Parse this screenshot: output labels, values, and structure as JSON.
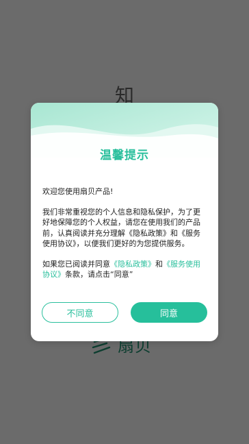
{
  "background": {
    "top_char": "知",
    "logo_text": "扇贝",
    "logo_icon": "shanbay-logo-icon"
  },
  "dialog": {
    "title": "温馨提示",
    "welcome": "欢迎您使用扇贝产品!",
    "body": "我们非常重视您的个人信息和隐私保护，为了更好地保障您的个人权益，请您在使用我们的产品前，认真阅读并充分理解《隐私政策》和《服务使用协议》，以便我们更好的为您提供服务。",
    "agree_prefix": "如果您已阅读并同意",
    "privacy_link": "《隐私政策》",
    "and": "和",
    "service_link": "《服务使用协议》",
    "agree_suffix": "条款，请点击“同意”",
    "disagree_label": "不同意",
    "agree_label": "同意"
  },
  "colors": {
    "accent": "#29bf9c",
    "overlay": "#6b6b6b",
    "header_wave": "#bfeedd"
  }
}
